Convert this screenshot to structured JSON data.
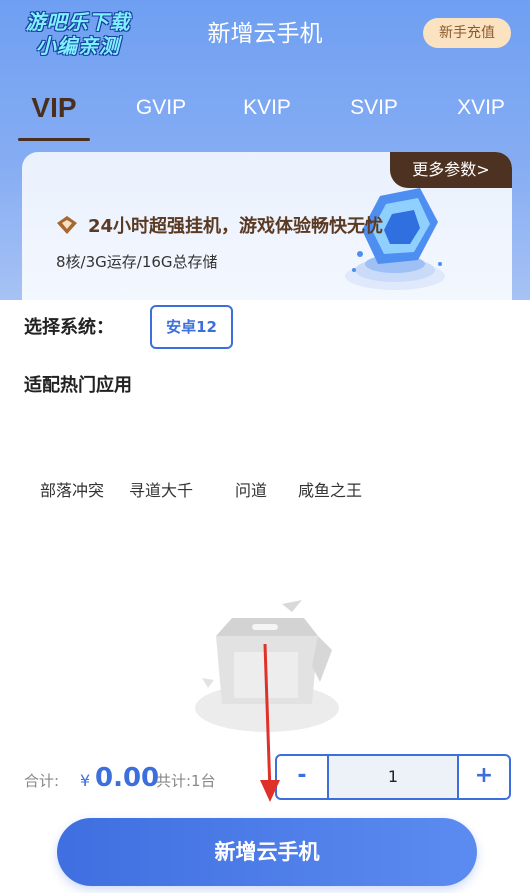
{
  "watermark": "游吧乐下载\n小编亲测",
  "header": {
    "title": "新增云手机",
    "newbie_recharge": "新手充值"
  },
  "tabs": [
    "VIP",
    "GVIP",
    "KVIP",
    "SVIP",
    "XVIP"
  ],
  "card": {
    "more_params": "更多参数>",
    "feature": "24小时超强挂机，游戏体验畅快无忧",
    "spec": "8核/3G运存/16G总存储"
  },
  "system": {
    "label": "选择系统：",
    "option": "安卓12"
  },
  "apps": {
    "title": "适配热门应用",
    "items": [
      "部落冲突",
      "寻道大千",
      "问道",
      "咸鱼之王"
    ]
  },
  "footer": {
    "total_label": "合计:",
    "currency": "¥",
    "amount": "0.00",
    "count": "共计:1台",
    "minus": "-",
    "quantity": "1",
    "plus": "+",
    "cta": "新增云手机"
  },
  "colors": {
    "accent": "#3d6fdc",
    "brown": "#4e3221",
    "annotation": "#e0302a"
  }
}
